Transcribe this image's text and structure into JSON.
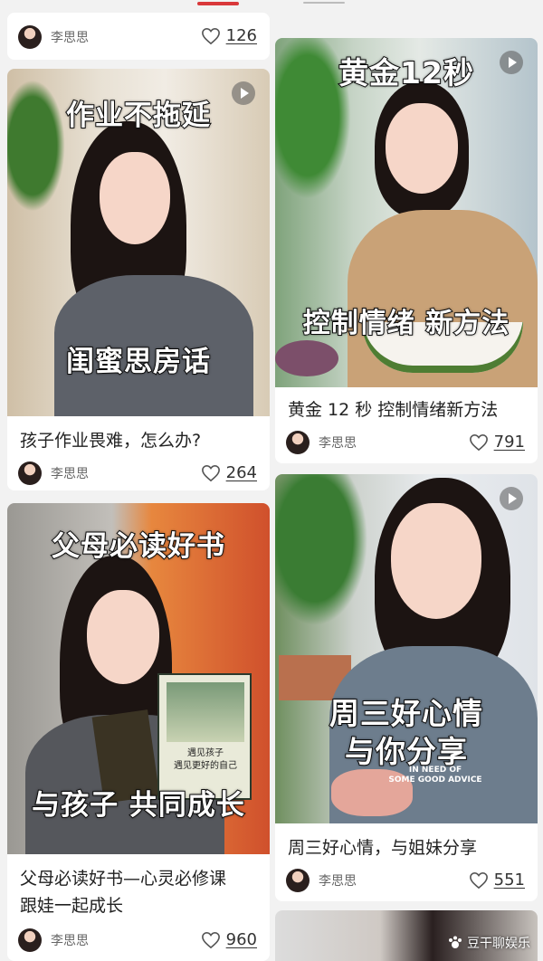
{
  "tabs": {
    "active_color": "#d9383a"
  },
  "top_partial": {
    "author": "李思思",
    "likes": "126"
  },
  "cards": [
    {
      "overlay_top": "作业不拖延",
      "overlay_bottom": "闺蜜思房话",
      "caption": "孩子作业畏难，怎么办?",
      "author": "李思思",
      "likes": "264"
    },
    {
      "overlay_top": "黄金12秒",
      "overlay_bottom": "控制情绪 新方法",
      "caption": "黄金 12 秒 控制情绪新方法",
      "author": "李思思",
      "likes": "791"
    },
    {
      "overlay_top": "父母必读好书",
      "overlay_bottom": "与孩子 共同成长",
      "caption_line1": "父母必读好书—心灵必修课",
      "caption_line2": "跟娃一起成长",
      "author": "李思思",
      "likes": "960",
      "book_title": "遇见孩子\n遇见更好的自己"
    },
    {
      "overlay_bottom_line1": "周三好心情",
      "overlay_bottom_line2": "与你分享",
      "shirt_text": "IN NEED OF\nSOME GOOD ADVICE",
      "caption": "周三好心情，与姐妹分享",
      "author": "李思思",
      "likes": "551"
    }
  ],
  "watermark": "豆干聊娱乐",
  "icons": {
    "like": "heart-outline-icon",
    "play": "play-icon"
  }
}
